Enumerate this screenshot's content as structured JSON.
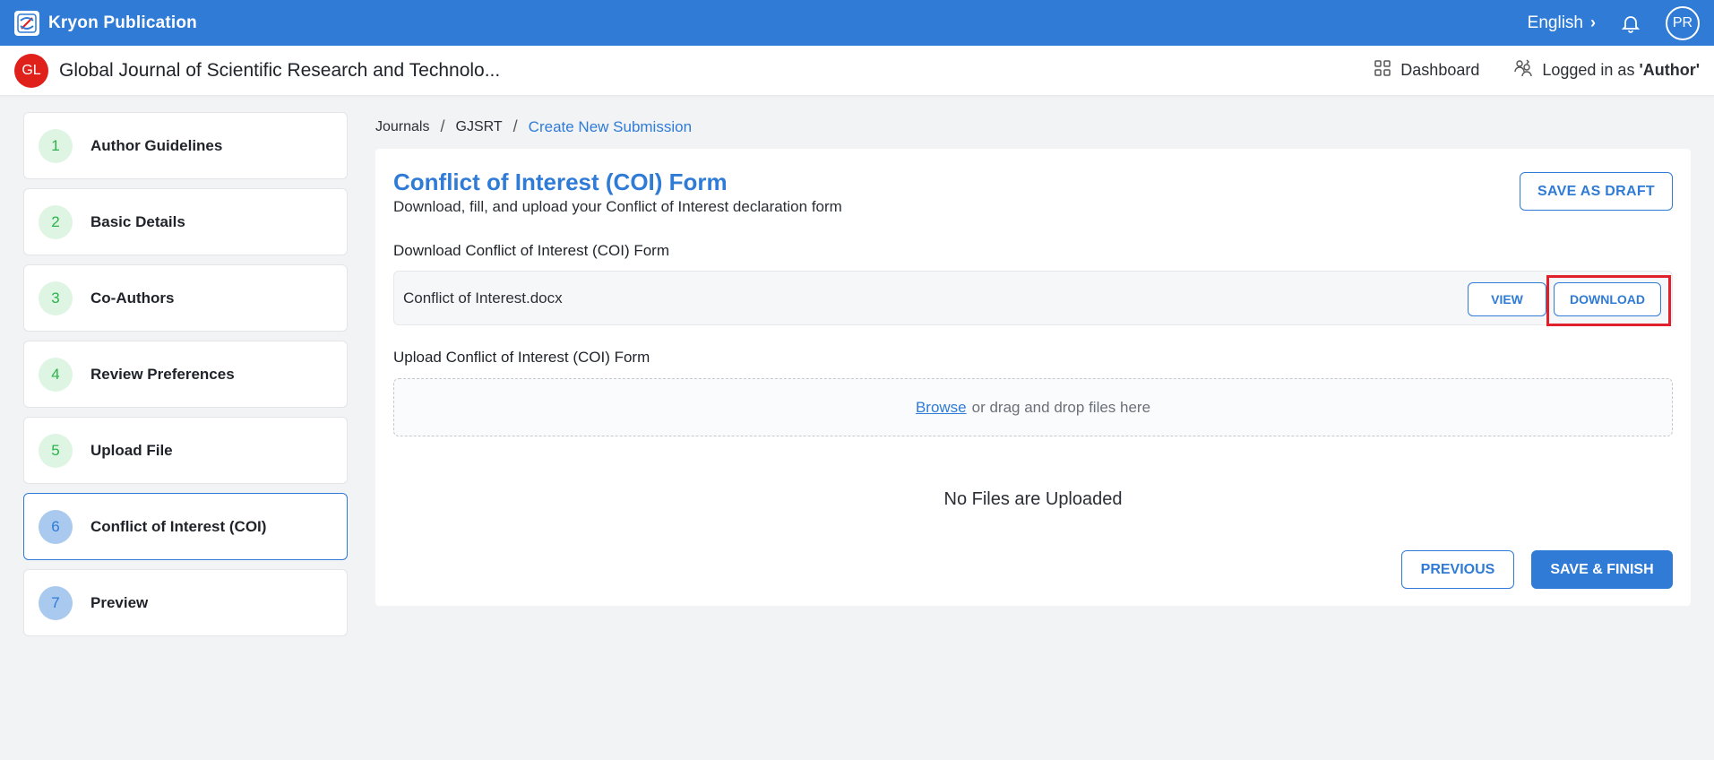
{
  "topbar": {
    "brand_name": "Kryon Publication",
    "language": "English",
    "user_initials": "PR",
    "colors": {
      "primary": "#2f7bd6"
    }
  },
  "journal": {
    "logo_initials": "GL",
    "title": "Global Journal of Scientific Research and Technolo...",
    "dashboard_label": "Dashboard",
    "logged_in_prefix": "Logged in as ",
    "logged_in_role": "'Author'",
    "logo_color": "#e0201b"
  },
  "steps": [
    {
      "number": "1",
      "label": "Author Guidelines",
      "state": "done"
    },
    {
      "number": "2",
      "label": "Basic Details",
      "state": "done"
    },
    {
      "number": "3",
      "label": "Co-Authors",
      "state": "done"
    },
    {
      "number": "4",
      "label": "Review Preferences",
      "state": "done"
    },
    {
      "number": "5",
      "label": "Upload File",
      "state": "done"
    },
    {
      "number": "6",
      "label": "Conflict of Interest (COI)",
      "state": "active"
    },
    {
      "number": "7",
      "label": "Preview",
      "state": "todo"
    }
  ],
  "breadcrumb": {
    "items": [
      "Journals",
      "GJSRT"
    ],
    "separator": "/",
    "current": "Create New Submission"
  },
  "form": {
    "title": "Conflict of Interest (COI) Form",
    "subtitle": "Download, fill, and upload your Conflict of Interest declaration form",
    "save_draft_label": "SAVE AS DRAFT",
    "download_section_label": "Download Conflict of Interest (COI) Form",
    "file_name": "Conflict of Interest.docx",
    "view_label": "VIEW",
    "download_label": "DOWNLOAD",
    "upload_section_label": "Upload Conflict of Interest (COI) Form",
    "browse_label": "Browse",
    "drop_text": "or drag and drop files here",
    "no_files_text": "No Files are Uploaded",
    "previous_label": "PREVIOUS",
    "finish_label": "SAVE & FINISH"
  }
}
